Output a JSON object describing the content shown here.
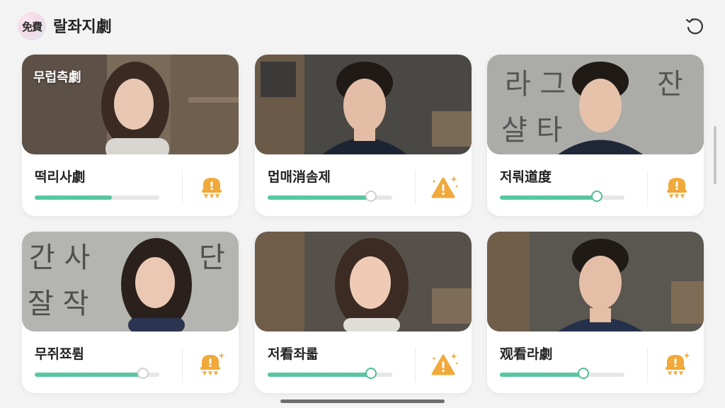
{
  "app": {
    "logo_text": "免費",
    "title": "랄좌지劇"
  },
  "cards": [
    {
      "title": "떡리사劇",
      "overlay": "무럽측劇",
      "progress": 0.62,
      "alert_icon": "warning-badge-icon"
    },
    {
      "title": "멉매消솜제",
      "overlay": "",
      "progress": 0.83,
      "alert_icon": "warning-sparkle-icon"
    },
    {
      "title": "저뤄道度",
      "overlay": "",
      "progress": 0.78,
      "alert_icon": "warning-badge-icon"
    },
    {
      "title": "무쥐쬬륌",
      "overlay": "",
      "progress": 0.87,
      "alert_icon": "warning-sparkle-badge-icon"
    },
    {
      "title": "저看좌롧",
      "overlay": "",
      "progress": 0.83,
      "alert_icon": "warning-sparkle-icon"
    },
    {
      "title": "观看라劇",
      "overlay": "",
      "progress": 0.67,
      "alert_icon": "warning-sparkle-badge-icon"
    }
  ],
  "colors": {
    "accent": "#55c9a0",
    "alert": "#f0a93a",
    "background": "#f3f3f4"
  }
}
